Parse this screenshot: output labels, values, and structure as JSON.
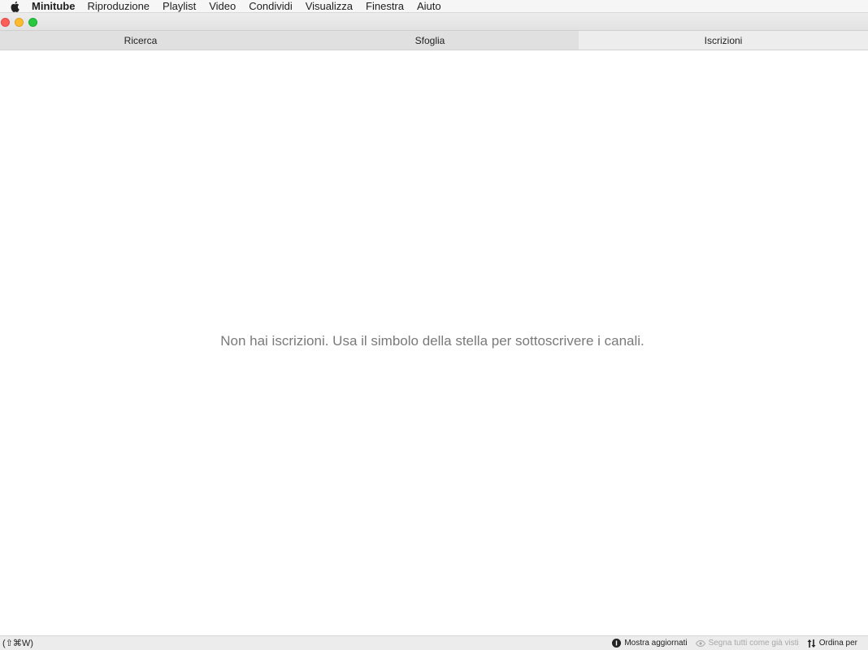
{
  "menubar": {
    "app_name": "Minitube",
    "items": [
      "Riproduzione",
      "Playlist",
      "Video",
      "Condividi",
      "Visualizza",
      "Finestra",
      "Aiuto"
    ]
  },
  "tabs": [
    {
      "label": "Ricerca"
    },
    {
      "label": "Sfoglia"
    },
    {
      "label": "Iscrizioni"
    }
  ],
  "main": {
    "empty_message": "Non hai iscrizioni. Usa il simbolo della stella per sottoscrivere i canali."
  },
  "statusbar": {
    "shortcut_hint": "(⇧⌘W)",
    "show_updated_label": "Mostra aggiornati",
    "mark_all_watched_label": "Segna tutti come già visti",
    "sort_by_label": "Ordina per"
  },
  "colors": {
    "close": "#fc5f57",
    "minimize": "#fdbc2e",
    "maximize": "#28c840"
  }
}
